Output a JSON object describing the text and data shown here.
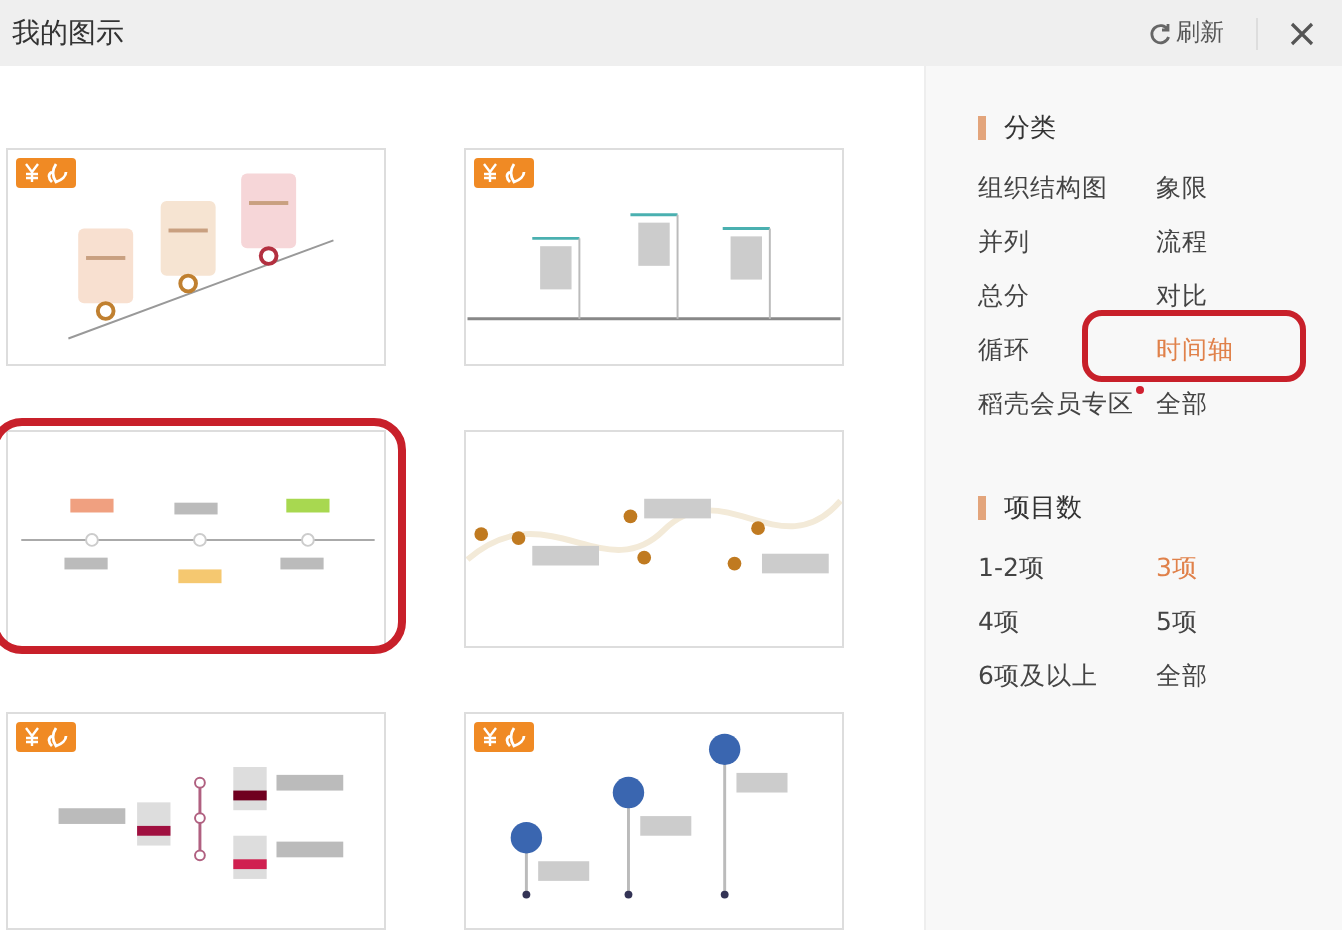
{
  "window": {
    "title": "我的图示",
    "refresh": "刷新"
  },
  "thumbnails": [
    {
      "kind": "slope",
      "premium": true,
      "circled": false
    },
    {
      "kind": "columns",
      "premium": true,
      "circled": false
    },
    {
      "kind": "markers",
      "premium": false,
      "circled": true
    },
    {
      "kind": "wave",
      "premium": false,
      "circled": false
    },
    {
      "kind": "branch",
      "premium": true,
      "circled": false
    },
    {
      "kind": "pins",
      "premium": true,
      "circled": false
    }
  ],
  "sidebar": {
    "sections": [
      {
        "title": "分类",
        "items": [
          {
            "label": "组织结构图",
            "selected": false,
            "circled": false,
            "dot": false
          },
          {
            "label": "象限",
            "selected": false,
            "circled": false,
            "dot": false
          },
          {
            "label": "并列",
            "selected": false,
            "circled": false,
            "dot": false
          },
          {
            "label": "流程",
            "selected": false,
            "circled": false,
            "dot": false
          },
          {
            "label": "总分",
            "selected": false,
            "circled": false,
            "dot": false
          },
          {
            "label": "对比",
            "selected": false,
            "circled": false,
            "dot": false
          },
          {
            "label": "循环",
            "selected": false,
            "circled": false,
            "dot": false
          },
          {
            "label": "时间轴",
            "selected": true,
            "circled": true,
            "dot": false
          },
          {
            "label": "稻壳会员专区",
            "selected": false,
            "circled": false,
            "dot": true
          },
          {
            "label": "全部",
            "selected": false,
            "circled": false,
            "dot": false
          }
        ]
      },
      {
        "title": "项目数",
        "items": [
          {
            "label": "1-2项",
            "selected": false,
            "circled": false,
            "dot": false
          },
          {
            "label": "3项",
            "selected": true,
            "circled": false,
            "dot": false
          },
          {
            "label": "4项",
            "selected": false,
            "circled": false,
            "dot": false
          },
          {
            "label": "5项",
            "selected": false,
            "circled": false,
            "dot": false
          },
          {
            "label": "6项及以上",
            "selected": false,
            "circled": false,
            "dot": false
          },
          {
            "label": "全部",
            "selected": false,
            "circled": false,
            "dot": false
          }
        ]
      }
    ]
  }
}
